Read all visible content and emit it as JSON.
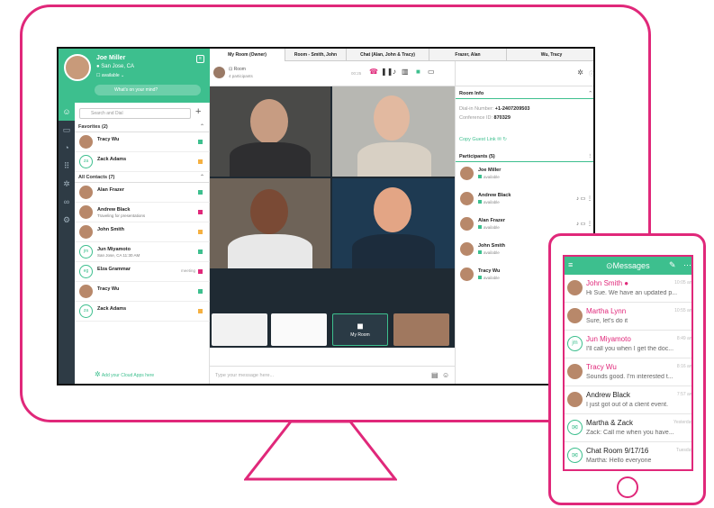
{
  "user": {
    "name": "Joe Miller",
    "location": "San Jose, CA",
    "status": "available",
    "mind_placeholder": "What's on your mind?"
  },
  "sidebar": {
    "search_placeholder": "Search and Dial",
    "favorites_header": "Favorites (2)",
    "all_contacts_header": "All Contacts (7)",
    "favorites": [
      {
        "name": "Tracy Wu",
        "sub": "",
        "status_color": "#3dbf8e"
      },
      {
        "name": "Zack Adams",
        "sub": "",
        "initials": "za",
        "status_color": "#f5b041"
      }
    ],
    "contacts": [
      {
        "name": "Alan Frazer",
        "sub": "",
        "status_color": "#3dbf8e"
      },
      {
        "name": "Andrew Black",
        "sub": "Traveling for presentations",
        "status_color": "#e0287a"
      },
      {
        "name": "John Smith",
        "sub": "",
        "status_color": "#f5b041"
      },
      {
        "name": "Jun Miyamoto",
        "sub": "San Jose, CA 11:30 AM",
        "initials": "jm",
        "status_color": "#3dbf8e"
      },
      {
        "name": "Elza Grammar",
        "sub": "",
        "initials": "eg",
        "tag": "meeting",
        "status_color": "#e0287a"
      },
      {
        "name": "Tracy Wu",
        "sub": "",
        "status_color": "#3dbf8e"
      },
      {
        "name": "Zack Adams",
        "sub": "",
        "initials": "za",
        "status_color": "#f5b041"
      }
    ],
    "cloud_apps": "Add your Cloud Apps here"
  },
  "tabs": [
    {
      "label": "My Room (Owner)",
      "active": true
    },
    {
      "label": "Room - Smith, John"
    },
    {
      "label": "Chat (Alan, John & Tracy)"
    },
    {
      "label": "Frazer, Alan"
    },
    {
      "label": "Wu, Tracy"
    }
  ],
  "room": {
    "label": "Room",
    "participants_text": "4 participants",
    "timer": "00:25",
    "my_room": "My Room",
    "message_placeholder": "Type your message here..."
  },
  "room_info": {
    "header": "Room Info",
    "dial_label": "Dial-in Number:",
    "dial_value": "+1-2407209503",
    "conf_label": "Conference ID:",
    "conf_value": "870329",
    "guest_link": "Copy Guest Link"
  },
  "participants": {
    "header": "Participants (5)",
    "items": [
      {
        "name": "Joe Miller",
        "status": "available"
      },
      {
        "name": "Andrew Black",
        "status": "available"
      },
      {
        "name": "Alan Frazer",
        "status": "available"
      },
      {
        "name": "John Smith",
        "status": "available"
      },
      {
        "name": "Tracy Wu",
        "status": "available"
      }
    ]
  },
  "phone": {
    "title": "Messages",
    "messages": [
      {
        "name": "John Smith",
        "time": "10:05 am",
        "preview": "Hi Sue. We have an updated p...",
        "pink": true,
        "unread": true
      },
      {
        "name": "Martha Lynn",
        "time": "10:55 am",
        "preview": "Sure, let's do it",
        "pink": true
      },
      {
        "name": "Jun Miyamoto",
        "time": "8:49 am",
        "preview": "I'll call you when I get the doc...",
        "pink": true,
        "initials": "jm"
      },
      {
        "name": "Tracy Wu",
        "time": "8:16 am",
        "preview": "Sounds good. I'm interested t...",
        "pink": true
      },
      {
        "name": "Andrew Black",
        "time": "7:57 am",
        "preview": "I just got out of a client event."
      },
      {
        "name": "Martha & Zack",
        "time": "Yesterday",
        "preview": "Zack: Call me when you have...",
        "group": true
      },
      {
        "name": "Chat Room 9/17/16",
        "time": "Tuesday",
        "preview": "Martha: Hello everyone",
        "group": true
      }
    ]
  },
  "colors": {
    "accent": "#3dbf8e",
    "brand_pink": "#e0287a",
    "dark": "#1f2a33"
  }
}
